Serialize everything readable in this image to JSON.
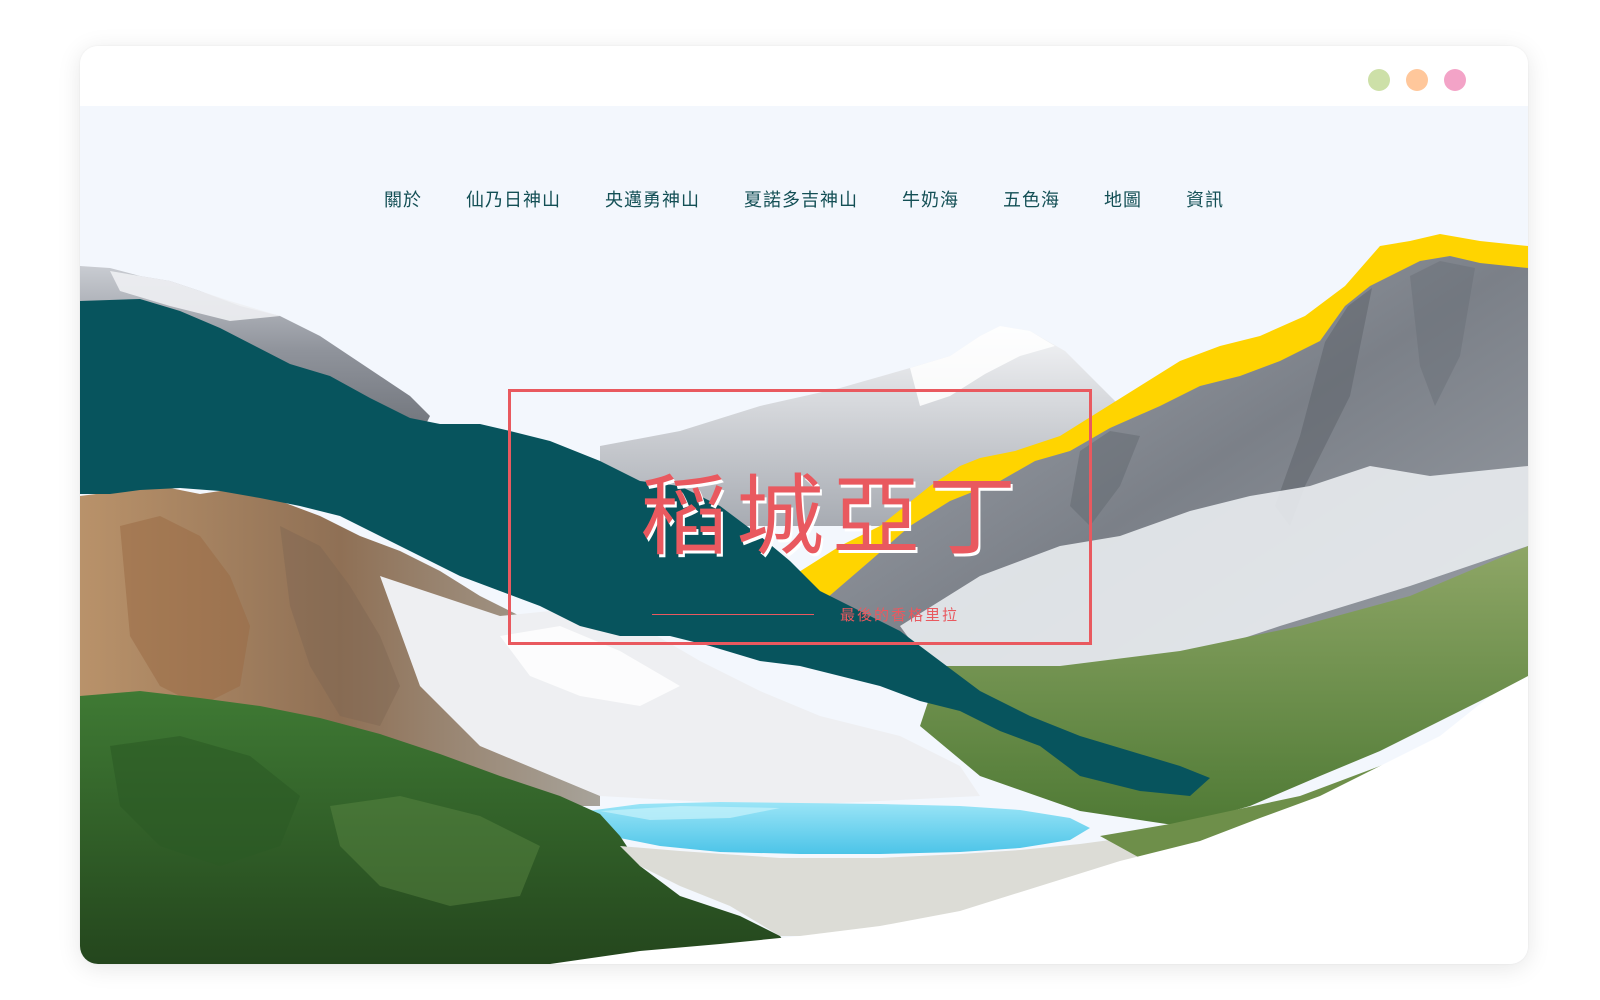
{
  "window": {
    "controls": [
      {
        "name": "green-dot",
        "color": "#cde0a8"
      },
      {
        "name": "orange-dot",
        "color": "#ffc79b"
      },
      {
        "name": "pink-dot",
        "color": "#f3a3c7"
      }
    ]
  },
  "nav": {
    "items": [
      {
        "label": "關於"
      },
      {
        "label": "仙乃日神山"
      },
      {
        "label": "央邁勇神山"
      },
      {
        "label": "夏諾多吉神山"
      },
      {
        "label": "牛奶海"
      },
      {
        "label": "五色海"
      },
      {
        "label": "地圖"
      },
      {
        "label": "資訊"
      }
    ]
  },
  "hero": {
    "title": "稻城亞丁",
    "subtitle": "最後的香格里拉"
  },
  "colors": {
    "accent": "#e9595f",
    "teal": "#07545d",
    "yellow": "#ffd400",
    "sky": "#f3f7fd",
    "lake": "#6fd2ef",
    "nav_text": "#134f55"
  }
}
